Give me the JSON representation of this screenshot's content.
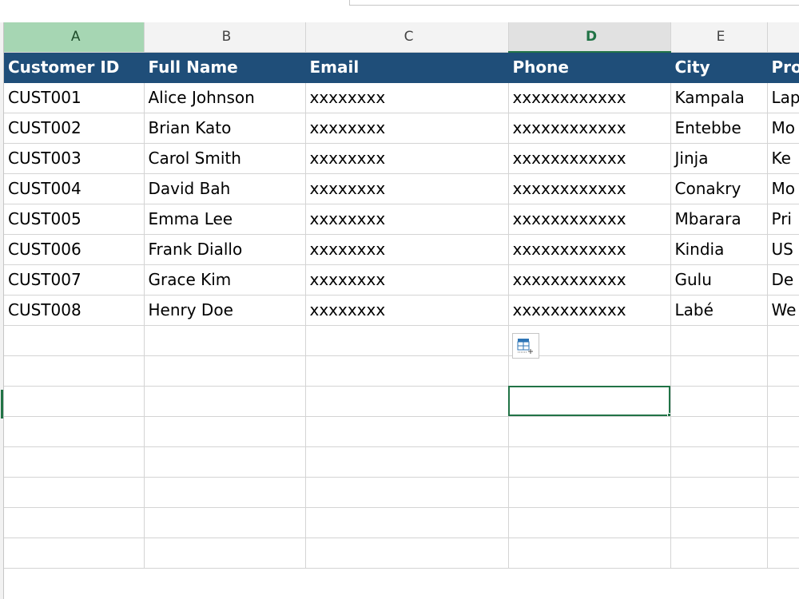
{
  "columns": [
    "A",
    "B",
    "C",
    "D",
    "E",
    ""
  ],
  "header": [
    "Customer ID",
    "Full Name",
    "Email",
    "Phone",
    "City",
    "Pro"
  ],
  "rows": [
    [
      "CUST001",
      "Alice Johnson",
      "xxxxxxxx",
      "xxxxxxxxxxxx",
      "Kampala",
      "Lap"
    ],
    [
      "CUST002",
      "Brian Kato",
      "xxxxxxxx",
      "xxxxxxxxxxxx",
      "Entebbe",
      "Mo"
    ],
    [
      "CUST003",
      "Carol Smith",
      "xxxxxxxx",
      "xxxxxxxxxxxx",
      "Jinja",
      "Ke"
    ],
    [
      "CUST004",
      "David Bah",
      "xxxxxxxx",
      "xxxxxxxxxxxx",
      "Conakry",
      "Mo"
    ],
    [
      "CUST005",
      "Emma Lee",
      "xxxxxxxx",
      "xxxxxxxxxxxx",
      "Mbarara",
      "Pri"
    ],
    [
      "CUST006",
      "Frank Diallo",
      "xxxxxxxx",
      "xxxxxxxxxxxx",
      "Kindia",
      "US"
    ],
    [
      "CUST007",
      "Grace Kim",
      "xxxxxxxx",
      "xxxxxxxxxxxx",
      "Gulu",
      "De"
    ],
    [
      "CUST008",
      "Henry Doe",
      "xxxxxxxx",
      "xxxxxxxxxxxx",
      "Labé",
      "We"
    ]
  ],
  "icons": {
    "paste_options": "paste-options-icon"
  },
  "colors": {
    "header_fill": "#1f4e79",
    "selection_accent": "#217346",
    "selected_column_header": "#a6d6b3"
  }
}
